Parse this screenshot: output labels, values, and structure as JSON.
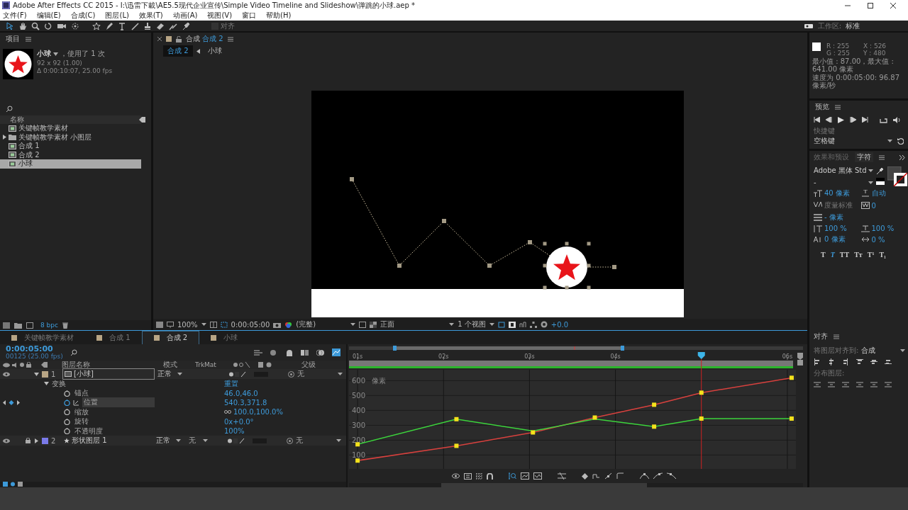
{
  "window": {
    "title": "Adobe After Effects CC 2015 - I:\\迅雷下載\\AE5.5现代企业宣传\\Simple Video Timeline and Slideshow\\弹跳的小球.aep *"
  },
  "menu": [
    "文件(F)",
    "编辑(E)",
    "合成(C)",
    "图层(L)",
    "效果(T)",
    "动画(A)",
    "视图(V)",
    "窗口",
    "帮助(H)"
  ],
  "toolbar": {
    "snap": {
      "checked": false
    },
    "snap_label": "对齐",
    "workspace_label": "工作区:",
    "workspace": "标准"
  },
  "project": {
    "title": "项目",
    "item_name": "小球",
    "usage": "，使用了 1 次",
    "size": "92 x 92 (1.00)",
    "duration": "Δ 0:00:10:07, 25.00 fps",
    "column": "名称",
    "bpc": "8 bpc",
    "items": [
      {
        "name": "关键帧教学素材",
        "kind": "comp",
        "selected": false
      },
      {
        "name": "关键帧教学素材 小图层",
        "kind": "folder",
        "selected": false
      },
      {
        "name": "合成 1",
        "kind": "comp",
        "selected": false
      },
      {
        "name": "合成 2",
        "kind": "comp",
        "selected": false
      },
      {
        "name": "小球",
        "kind": "comp",
        "selected": true
      }
    ]
  },
  "viewer": {
    "tab_label": "合成",
    "tab_comp": "合成 2",
    "breadcrumbs": [
      {
        "label": "合成 2",
        "selected": true
      },
      {
        "label": "小球",
        "selected": false
      }
    ],
    "zoom": "100%",
    "timecode": "0:00:05:00",
    "resolution": "(完整)",
    "view": "正面",
    "views": "1 个视图",
    "exposure": "+0.0"
  },
  "info": {
    "r": "R : 255",
    "g": "G : 255",
    "x": "X : 526",
    "y": "Y : 480",
    "range": "最小值 : 87.00，最大值 : 641.00 像素",
    "speed": "速度为 0:00:05:00: 96.87 像素/秒"
  },
  "preview": {
    "title": "预览",
    "shortcut_label": "快捷键",
    "shortcut": "空格键"
  },
  "character": {
    "tabs": [
      {
        "label": "效果和预设",
        "selected": false
      },
      {
        "label": "字符",
        "selected": true
      }
    ],
    "font": "Adobe 黑体 Std",
    "style": "-",
    "size": "40 像素",
    "leading": "自动",
    "kerning": "度量标准",
    "tracking": "0",
    "stroke": "- 像素",
    "vscale": "100 %",
    "hscale": "100 %",
    "baseline": "0 像素",
    "tsume": "0 %",
    "text_styles": [
      {
        "label": "T",
        "selected": false
      },
      {
        "label": "T",
        "selected": true
      },
      {
        "label": "TT",
        "selected": false
      },
      {
        "label": "Tт",
        "selected": false
      },
      {
        "label": "T¹",
        "selected": false
      },
      {
        "label": "T₁",
        "selected": false
      }
    ]
  },
  "align": {
    "title": "对齐",
    "align_to_label": "将图层对齐到:",
    "align_to": "合成",
    "distribute_label": "分布图层:"
  },
  "timeline": {
    "tabs": [
      {
        "label": "关键帧教学素材",
        "selected": false
      },
      {
        "label": "合成 1",
        "selected": false
      },
      {
        "label": "合成 2",
        "selected": true
      },
      {
        "label": "小球",
        "selected": false
      }
    ],
    "timecode": "0:00:05:00",
    "frames": "00125 (25.00 fps)",
    "columns": {
      "layer_name": "图层名称",
      "mode": "模式",
      "trkmat": "TrkMat",
      "parent": "父级"
    },
    "layers": [
      {
        "index": "1",
        "name": "[小球]",
        "mode": "正常",
        "parent": "无",
        "color": "#b8a585",
        "locked": false,
        "expanded": true,
        "group": "变换",
        "reset": "重置",
        "properties": [
          {
            "name": "锚点",
            "value": "46.0,46.0",
            "animated": false,
            "selected": false
          },
          {
            "name": "位置",
            "value": "540.3,371.8",
            "animated": true,
            "selected": true
          },
          {
            "name": "缩放",
            "value": "100.0,100.0%",
            "animated": false,
            "selected": false
          },
          {
            "name": "旋转",
            "value": "0x+0.0°",
            "animated": false,
            "selected": false
          },
          {
            "name": "不透明度",
            "value": "100%",
            "animated": false,
            "selected": false
          }
        ]
      },
      {
        "index": "2",
        "name": "形状图层 1",
        "mode": "正常",
        "trkmat": "无",
        "parent": "无",
        "color": "#7a7ae8",
        "locked": true,
        "expanded": false
      }
    ],
    "graph": {
      "chart_data": {
        "type": "line",
        "ylabel": "像素",
        "x": [
          1.0,
          2.15,
          3.04,
          3.76,
          4.45,
          5.0,
          6.05
        ],
        "xticks": [
          {
            "value": 1,
            "label": "01s"
          },
          {
            "value": 2,
            "label": "02s"
          },
          {
            "value": 3,
            "label": "03s"
          },
          {
            "value": 4,
            "label": "04s"
          },
          {
            "value": 6,
            "label": "06s"
          }
        ],
        "yticks": [
          100,
          200,
          300,
          400,
          500,
          600
        ],
        "grid": true,
        "xlim": [
          0.9,
          6.1
        ],
        "ylim": [
          7,
          673
        ],
        "ref_lines": [
          {
            "axis": "x",
            "value": 5
          }
        ],
        "series": [
          {
            "color": "#d8413e",
            "marker": "square",
            "values": [
              63,
              162,
              252,
              352,
              438,
              519,
              619
            ]
          },
          {
            "color": "#3cd43c",
            "marker": "square",
            "values": [
              172,
              341,
              261,
              343,
              291,
              345,
              345
            ]
          }
        ]
      }
    }
  }
}
